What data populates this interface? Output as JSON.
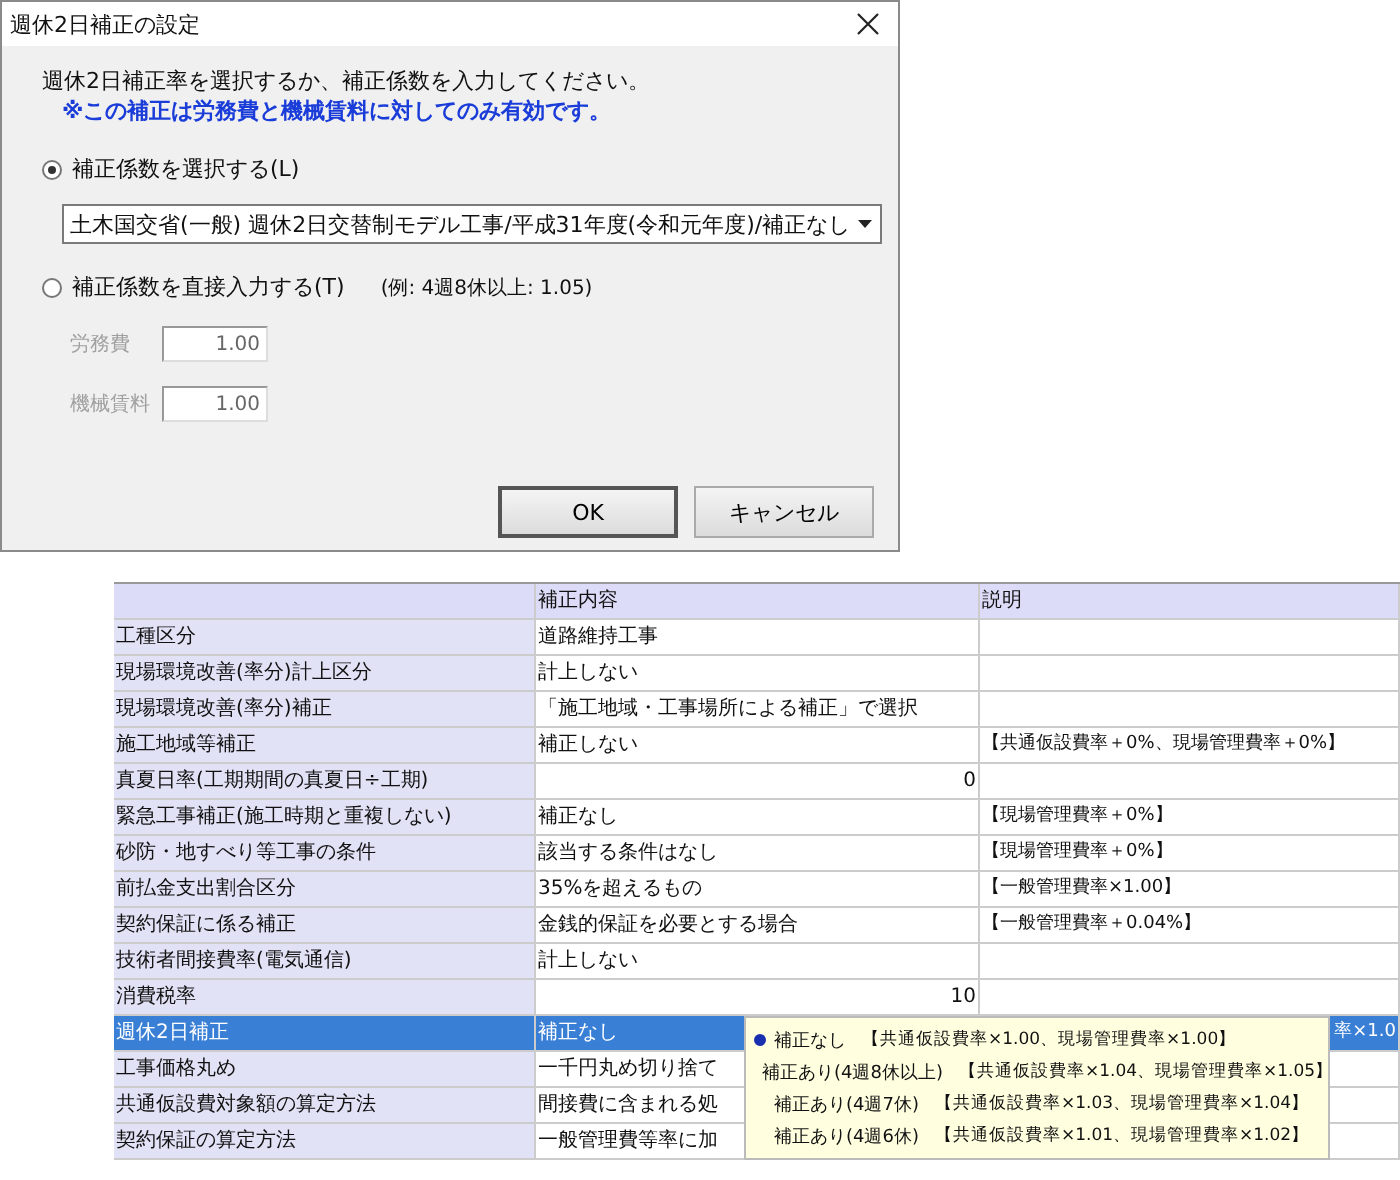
{
  "dialog": {
    "title": "週休2日補正の設定",
    "instruction": "週休2日補正率を選択するか、補正係数を入力してください。",
    "note": "※この補正は労務費と機械賃料に対してのみ有効です。",
    "options": [
      {
        "label": "補正係数を選択する(L)",
        "selected": true
      },
      {
        "label": "補正係数を直接入力する(T)",
        "selected": false
      }
    ],
    "select": {
      "value": "土木国交省(一般) 週休2日交替制モデル工事/平成31年度(令和元年度)/補正なし"
    },
    "example": "(例: 4週8休以上: 1.05)",
    "fields": [
      {
        "label": "労務費",
        "value": "1.00",
        "disabled": true
      },
      {
        "label": "機械賃料",
        "value": "1.00",
        "disabled": true
      }
    ],
    "buttons": [
      {
        "label": "OK",
        "default": true
      },
      {
        "label": "キャンセル",
        "default": false
      }
    ]
  },
  "grid": {
    "columns": [
      "補正内容",
      "説明"
    ],
    "rows": [
      {
        "label": "工種区分",
        "content": "道路維持工事",
        "kind": "text",
        "selected": false
      },
      {
        "label": "現場環境改善(率分)計上区分",
        "content": "計上しない",
        "kind": "text",
        "selected": false
      },
      {
        "label": "現場環境改善(率分)補正",
        "content": "「施工地域・工事場所による補正」で選択",
        "kind": "text",
        "selected": false
      },
      {
        "label": "施工地域等補正",
        "content": "補正しない",
        "note": "【共通仮設費率＋0%、現場管理費率＋0%】",
        "kind": "text",
        "selected": false
      },
      {
        "label": "真夏日率(工期期間の真夏日÷工期)",
        "content": "0",
        "kind": "number",
        "selected": false
      },
      {
        "label": "緊急工事補正(施工時期と重複しない)",
        "content": "補正なし",
        "note": "【現場管理費率＋0%】",
        "kind": "text",
        "selected": false
      },
      {
        "label": "砂防・地すべり等工事の条件",
        "content": "該当する条件はなし",
        "note": "【現場管理費率＋0%】",
        "kind": "text",
        "selected": false
      },
      {
        "label": "前払金支出割合区分",
        "content": "35%を超えるもの",
        "note": "【一般管理費率×1.00】",
        "kind": "text",
        "selected": false
      },
      {
        "label": "契約保証に係る補正",
        "content": "金銭的保証を必要とする場合",
        "note": "【一般管理費率＋0.04%】",
        "kind": "text",
        "selected": false
      },
      {
        "label": "技術者間接費率(電気通信)",
        "content": "計上しない",
        "kind": "text",
        "selected": false
      },
      {
        "label": "消費税率",
        "content": "10",
        "kind": "number",
        "selected": false
      },
      {
        "label": "週休2日補正",
        "content": "補正なし",
        "note": "率×1.0",
        "kind": "text",
        "selected": true
      },
      {
        "label": "工事価格丸め",
        "content": "一千円丸め切り捨て",
        "kind": "text",
        "selected": false
      },
      {
        "label": "共通仮設費対象額の算定方法",
        "content": "間接費に含まれる処",
        "kind": "text",
        "selected": false
      },
      {
        "label": "契約保証の算定方法",
        "content": "一般管理費等率に加",
        "kind": "text",
        "selected": false
      }
    ],
    "dropdown": {
      "items": [
        {
          "label": "補正なし",
          "note": "【共通仮設費率×1.00、現場管理費率×1.00】",
          "selected": true
        },
        {
          "label": "補正あり(4週8休以上)",
          "note": "【共通仮設費率×1.04、現場管理費率×1.05】",
          "selected": false
        },
        {
          "label": "補正あり(4週7休)",
          "note": "【共通仮設費率×1.03、現場管理費率×1.04】",
          "selected": false
        },
        {
          "label": "補正あり(4週6休)",
          "note": "【共通仮設費率×1.01、現場管理費率×1.02】",
          "selected": false
        }
      ]
    }
  }
}
